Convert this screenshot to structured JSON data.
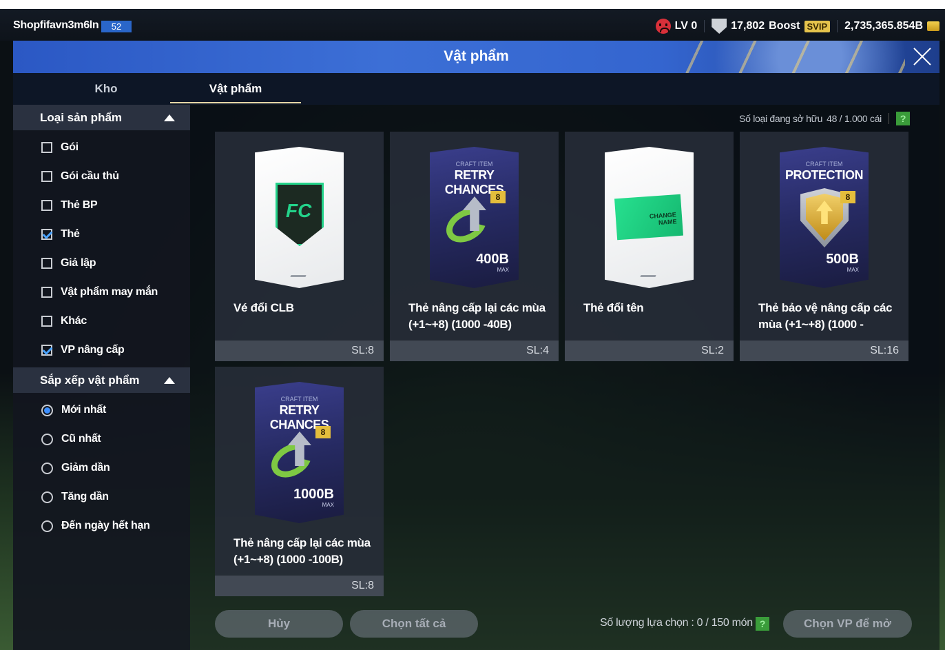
{
  "status": {
    "username": "Shopfifavn3m6ln",
    "level_badge": "52",
    "lv": "LV 0",
    "points": "17,802",
    "boost": "Boost",
    "svip": "SVIP",
    "balance": "2,735,365.854B"
  },
  "panel": {
    "title": "Vật phẩm"
  },
  "tabs": [
    {
      "label": "Kho",
      "active": false
    },
    {
      "label": "Vật phẩm",
      "active": true
    }
  ],
  "sidebar": {
    "filter_header": "Loại sản phẩm",
    "filters": [
      {
        "label": "Gói",
        "checked": false
      },
      {
        "label": "Gói cầu thủ",
        "checked": false
      },
      {
        "label": "Thẻ BP",
        "checked": false
      },
      {
        "label": "Thẻ",
        "checked": true
      },
      {
        "label": "Giả lập",
        "checked": false
      },
      {
        "label": "Vật phẩm may mắn",
        "checked": false
      },
      {
        "label": "Khác",
        "checked": false
      },
      {
        "label": "VP nâng cấp",
        "checked": true
      }
    ],
    "sort_header": "Sắp xếp vật phẩm",
    "sorts": [
      {
        "label": "Mới nhất",
        "checked": true
      },
      {
        "label": "Cũ nhất",
        "checked": false
      },
      {
        "label": "Giảm dần",
        "checked": false
      },
      {
        "label": "Tăng dần",
        "checked": false
      },
      {
        "label": "Đến ngày hết hạn",
        "checked": false
      }
    ]
  },
  "owned": {
    "label": "Số loại đang sở hữu",
    "value": "48 / 1.000 cái",
    "help": "?"
  },
  "items": [
    {
      "name": "Vé đổi CLB",
      "qty": "SL:8"
    },
    {
      "name": "Thẻ nâng cấp lại các mùa (+1~+8) (1000 -40B)",
      "qty": "SL:4",
      "card_small": "CRAFT ITEM",
      "card_big": "RETRY CHANCES",
      "card_value": "400B",
      "card_max": "MAX",
      "badge": "8"
    },
    {
      "name": "Thẻ đổi tên",
      "qty": "SL:2",
      "ticket_line1": "CHANGE",
      "ticket_line2": "NAME"
    },
    {
      "name": "Thẻ bảo vệ nâng cấp các mùa (+1~+8) (1000 -",
      "qty": "SL:16",
      "card_small": "CRAFT ITEM",
      "card_big": "PROTECTION",
      "card_value": "500B",
      "card_max": "MAX",
      "badge": "8"
    },
    {
      "name": "Thẻ nâng cấp lại các mùa (+1~+8) (1000 -100B)",
      "qty": "SL:8",
      "card_small": "CRAFT ITEM",
      "card_big": "RETRY CHANCES",
      "card_value": "1000B",
      "card_max": "MAX",
      "badge": "8"
    }
  ],
  "footer": {
    "cancel": "Hủy",
    "select_all": "Chọn tất cả",
    "selection_count": "Số lượng lựa chọn : 0 / 150 món",
    "help": "?",
    "open": "Chọn VP để mở"
  },
  "colors": {
    "accent": "#2b58c4",
    "checkbox_check": "#4aa3ff",
    "help_green": "#3a9c3a"
  }
}
